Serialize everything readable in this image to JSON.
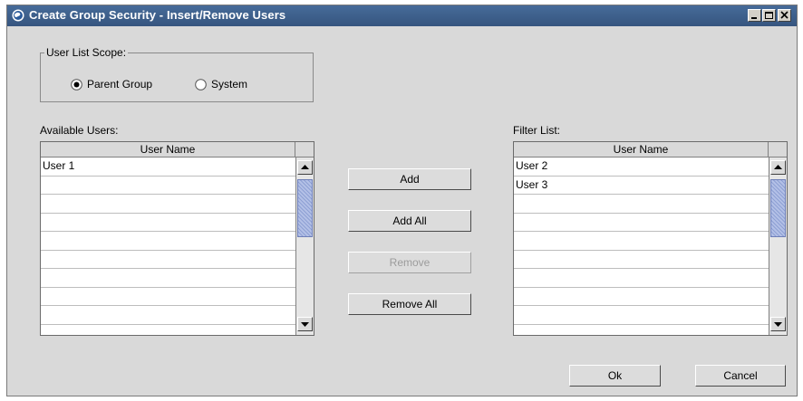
{
  "window": {
    "title": "Create Group Security - Insert/Remove Users",
    "icon": "app-globe-icon",
    "controls": [
      "minimize-icon",
      "maximize-icon",
      "close-icon"
    ]
  },
  "scope": {
    "legend": "User List Scope:",
    "options": [
      {
        "label": "Parent Group",
        "selected": true
      },
      {
        "label": "System",
        "selected": false
      }
    ]
  },
  "available": {
    "label": "Available Users:",
    "column": "User Name",
    "rows": [
      "User 1",
      "",
      "",
      "",
      "",
      "",
      "",
      "",
      ""
    ]
  },
  "filter": {
    "label": "Filter List:",
    "column": "User Name",
    "rows": [
      "User 2",
      "User 3",
      "",
      "",
      "",
      "",
      "",
      "",
      ""
    ]
  },
  "actions": {
    "add": "Add",
    "add_all": "Add All",
    "remove": "Remove",
    "remove_all": "Remove All"
  },
  "footer": {
    "ok": "Ok",
    "cancel": "Cancel"
  },
  "colors": {
    "titlebar": "#3f6190",
    "window_bg": "#d9d9d9",
    "scroll_thumb": "#9aa9d9"
  }
}
